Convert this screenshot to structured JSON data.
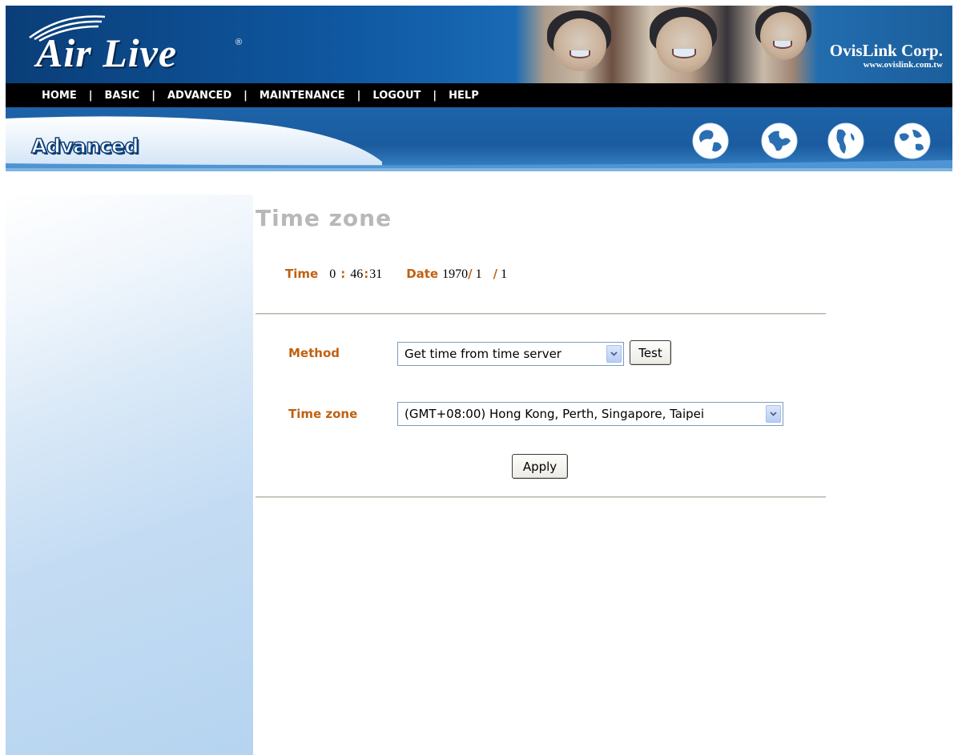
{
  "header": {
    "logo": "Air Live",
    "logo_reg": "®",
    "corp_name": "OvisLink Corp.",
    "corp_url": "www.ovislink.com.tw"
  },
  "nav": {
    "items": [
      "HOME",
      "BASIC",
      "ADVANCED",
      "MAINTENANCE",
      "LOGOUT",
      "HELP"
    ],
    "separator": "|"
  },
  "section": {
    "title": "Advanced"
  },
  "page": {
    "title": "Time zone",
    "time_label": "Time",
    "time_hour": "0",
    "time_sep1": ":",
    "time_minute": "46",
    "time_sep2": ":",
    "time_second": "31",
    "date_label": "Date",
    "date_year": "1970",
    "date_sep1": "/",
    "date_month": "1",
    "date_sep2": "/",
    "date_day": "1"
  },
  "form": {
    "method_label": "Method",
    "method_value": "Get time from time server",
    "test_button": "Test",
    "timezone_label": "Time zone",
    "timezone_value": "(GMT+08:00) Hong Kong, Perth, Singapore, Taipei",
    "apply_button": "Apply"
  },
  "colors": {
    "accent_orange": "#c06010",
    "nav_bg": "#000000",
    "banner_blue": "#1b5c9f",
    "title_gray": "#b8b8b8"
  }
}
